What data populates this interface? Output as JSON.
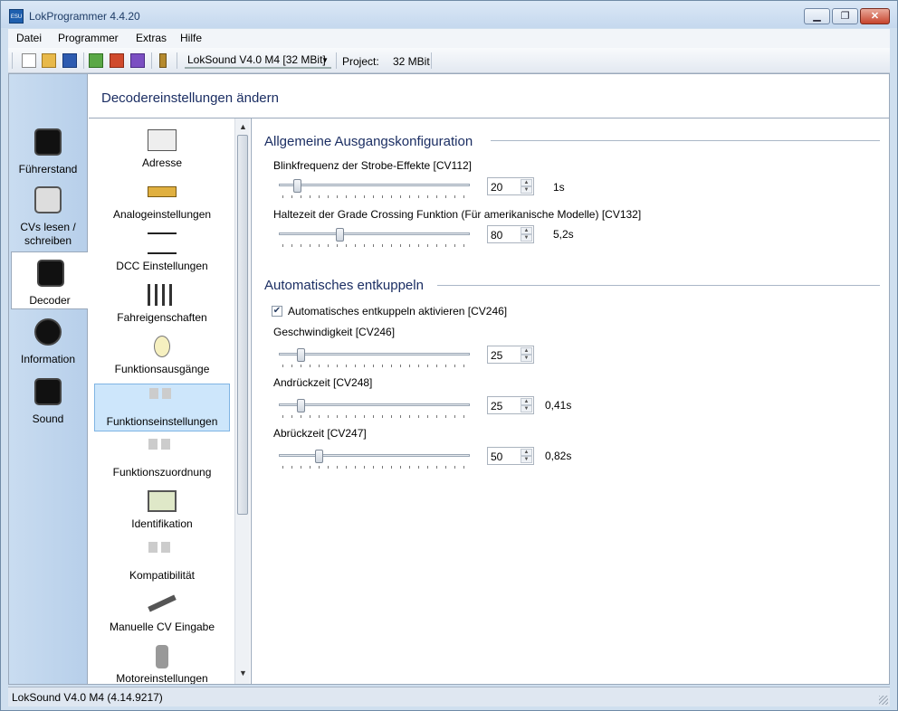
{
  "window": {
    "title": "LokProgrammer 4.4.20"
  },
  "menu": [
    "Datei",
    "Programmer",
    "Extras",
    "Hilfe"
  ],
  "toolbar": {
    "decoder": "LokSound V4.0 M4 [32 MBit]",
    "project_label": "Project:",
    "project_value": "32 MBit"
  },
  "nav": [
    {
      "label": "Führerstand",
      "icon": "cab-icon"
    },
    {
      "label": "CVs lesen / schreiben",
      "icon": "cv-icon"
    },
    {
      "label": "Decoder",
      "icon": "wrench-icon",
      "active": true
    },
    {
      "label": "Information",
      "icon": "info-icon"
    },
    {
      "label": "Sound",
      "icon": "music-icon"
    }
  ],
  "header": {
    "title": "Decodereinstellungen ändern"
  },
  "categories": [
    {
      "label": "Adresse",
      "icon": "envelope-icon"
    },
    {
      "label": "Analogeinstellungen",
      "icon": "gauge-icon"
    },
    {
      "label": "DCC Einstellungen",
      "icon": "dcc-icon"
    },
    {
      "label": "Fahreigenschaften",
      "icon": "sliders-icon"
    },
    {
      "label": "Funktionsausgänge",
      "icon": "bulb-icon"
    },
    {
      "label": "Funktionseinstellungen",
      "icon": "function-keys-icon",
      "selected": true
    },
    {
      "label": "Funktionszuordnung",
      "icon": "function-keys-icon"
    },
    {
      "label": "Identifikation",
      "icon": "id-card-icon"
    },
    {
      "label": "Kompatibilität",
      "icon": "function-keys-icon"
    },
    {
      "label": "Manuelle CV Eingabe",
      "icon": "wrench-icon"
    },
    {
      "label": "Motoreinstellungen",
      "icon": "motor-icon"
    }
  ],
  "sections": {
    "general": {
      "title": "Allgemeine Ausgangskonfiguration",
      "fields": [
        {
          "label": "Blinkfrequenz der Strobe-Effekte [CV112]",
          "value": "20",
          "unit": "1s",
          "level": 0.08
        },
        {
          "label": "Haltezeit der Grade Crossing Funktion (Für amerikanische Modelle) [CV132]",
          "value": "80",
          "unit": "5,2s",
          "level": 0.31
        }
      ]
    },
    "decouple": {
      "title": "Automatisches entkuppeln",
      "checkbox_label": "Automatisches entkuppeln aktivieren [CV246]",
      "checked": true,
      "fields": [
        {
          "label": "Geschwindigkeit [CV246]",
          "value": "25",
          "unit": "",
          "level": 0.1
        },
        {
          "label": "Andrückzeit [CV248]",
          "value": "25",
          "unit": "0,41s",
          "level": 0.1
        },
        {
          "label": "Abrückzeit [CV247]",
          "value": "50",
          "unit": "0,82s",
          "level": 0.2
        }
      ]
    }
  },
  "status": {
    "text": "LokSound V4.0 M4 (4.14.9217)"
  }
}
